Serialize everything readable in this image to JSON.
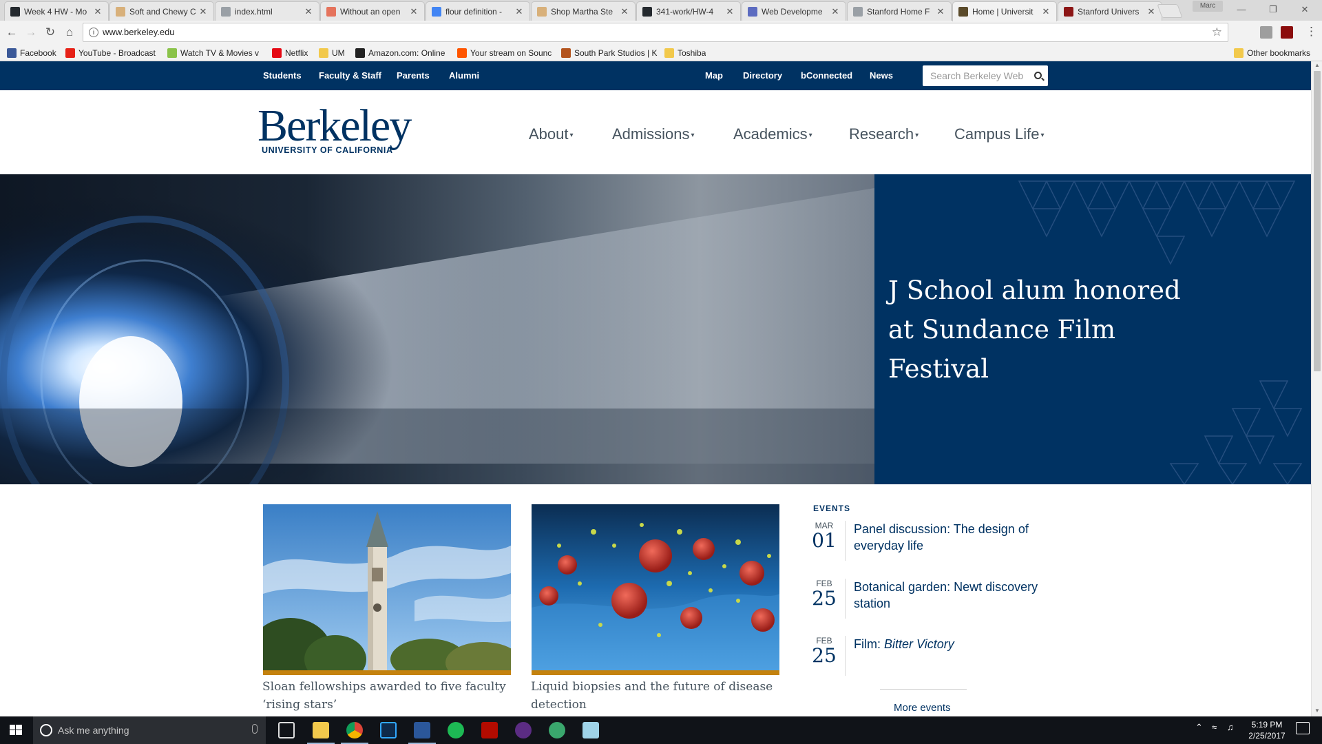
{
  "browser": {
    "tabs": [
      {
        "title": "Week 4 HW - Mo",
        "color": "#24292e"
      },
      {
        "title": "Soft and Chewy C",
        "color": "#d8b07a"
      },
      {
        "title": "index.html",
        "color": "#9aa0a6"
      },
      {
        "title": "Without an open",
        "color": "#e5735c"
      },
      {
        "title": "flour definition -",
        "color": "#4285f4"
      },
      {
        "title": "Shop Martha Ste",
        "color": "#d8b07a"
      },
      {
        "title": "341-work/HW-4",
        "color": "#24292e"
      },
      {
        "title": "Web Developme",
        "color": "#5c6bc0"
      },
      {
        "title": "Stanford Home F",
        "color": "#9aa0a6"
      },
      {
        "title": "Home | Universit",
        "color": "#5a4a2a",
        "active": true
      },
      {
        "title": "Stanford Univers",
        "color": "#8c1515"
      }
    ],
    "profile_name": "Marc",
    "url": "www.berkeley.edu",
    "bookmarks": [
      {
        "label": "Facebook",
        "color": "#3b5998"
      },
      {
        "label": "YouTube - Broadcast",
        "color": "#e62117"
      },
      {
        "label": "Watch TV & Movies v",
        "color": "#8bc34a"
      },
      {
        "label": "Netflix",
        "color": "#e50914"
      },
      {
        "label": "UM",
        "color": "folder"
      },
      {
        "label": "Amazon.com: Online",
        "color": "#222222"
      },
      {
        "label": "Your stream on Sounc",
        "color": "#ff5500"
      },
      {
        "label": "South Park Studios | K",
        "color": "#b3541e"
      },
      {
        "label": "Toshiba",
        "color": "folder"
      }
    ],
    "other_bookmarks": "Other bookmarks"
  },
  "site": {
    "utility_left": [
      "Students",
      "Faculty & Staff",
      "Parents",
      "Alumni"
    ],
    "utility_right": [
      "Map",
      "Directory",
      "bConnected",
      "News"
    ],
    "search_placeholder": "Search Berkeley Web",
    "logo_word": "Berkeley",
    "logo_sub": "UNIVERSITY OF CALIFORNIA",
    "main_nav": [
      "About",
      "Admissions",
      "Academics",
      "Research",
      "Campus Life"
    ],
    "hero_headline": "J School alum honored at Sundance Film Festival",
    "stories": [
      {
        "title": "Sloan fellowships awarded to five faculty ‘rising stars’"
      },
      {
        "title": "Liquid biopsies and the future of disease detection"
      }
    ],
    "events_heading": "EVENTS",
    "events": [
      {
        "month": "MAR",
        "day": "01",
        "title": "Panel discussion: The design of everyday life",
        "italic": ""
      },
      {
        "month": "FEB",
        "day": "25",
        "title": "Botanical garden: Newt discovery station",
        "italic": ""
      },
      {
        "month": "FEB",
        "day": "25",
        "title": "Film: ",
        "italic": "Bitter Victory"
      }
    ],
    "more_events": "More events",
    "colors": {
      "navy": "#003262",
      "gold": "#c4820e",
      "gray_text": "#46535e"
    }
  },
  "taskbar": {
    "search_text": "Ask me anything",
    "apps": [
      "file-explorer",
      "chrome",
      "photoshop",
      "word",
      "spotify",
      "acrobat",
      "mail-app",
      "web-app",
      "notes-app"
    ],
    "time": "5:19 PM",
    "date": "2/25/2017"
  }
}
